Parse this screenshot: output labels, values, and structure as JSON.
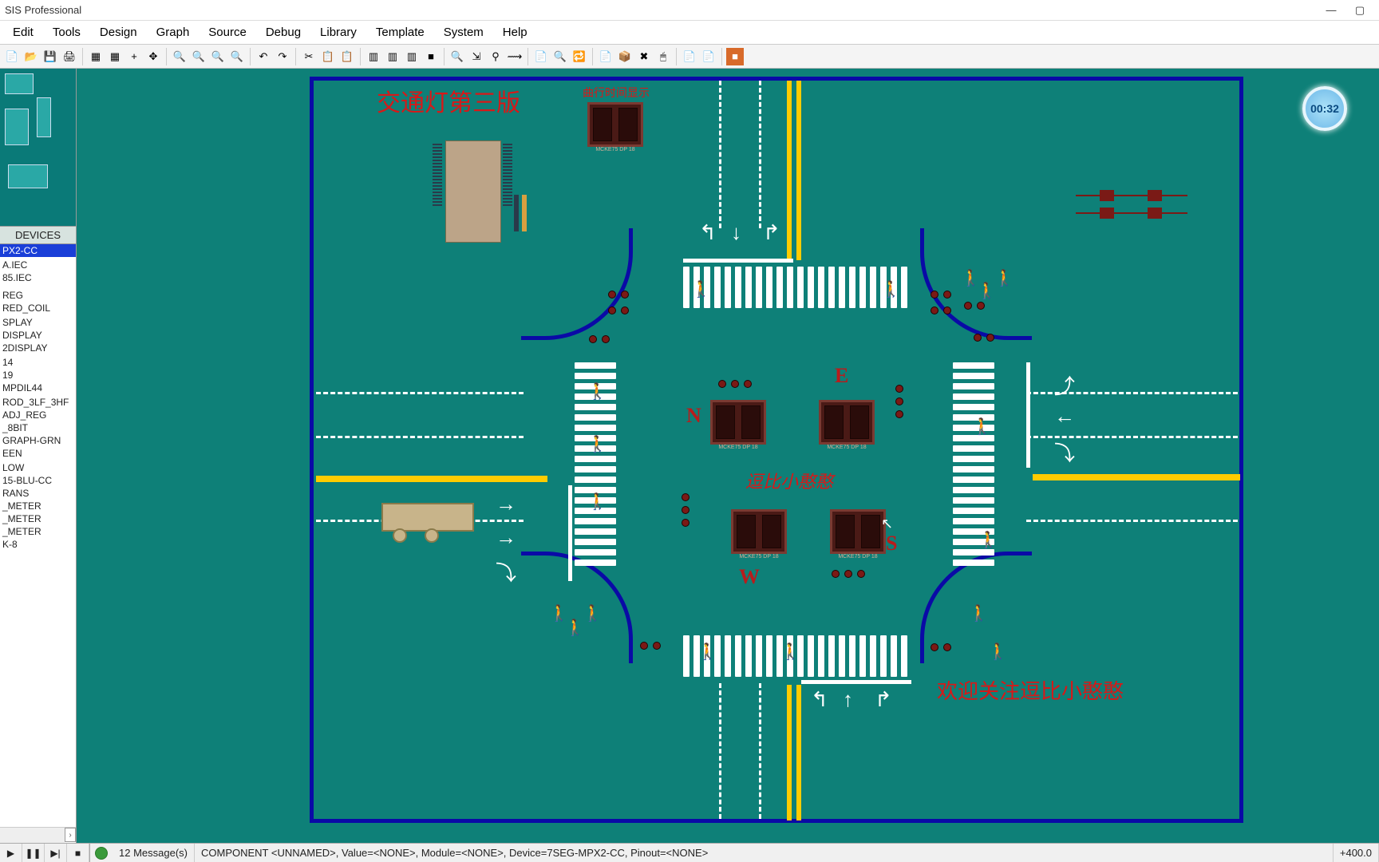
{
  "title": "SIS Professional",
  "menu": [
    "Edit",
    "Tools",
    "Design",
    "Graph",
    "Source",
    "Debug",
    "Library",
    "Template",
    "System",
    "Help"
  ],
  "toolbar_icons": [
    "new-icon",
    "open-icon",
    "save-icon",
    "print-icon",
    "region-icon",
    "grid-icon",
    "origin-icon",
    "pan-icon",
    "zoom-in-icon",
    "zoom-out-icon",
    "zoom-all-icon",
    "zoom-area-icon",
    "undo-icon",
    "redo-icon",
    "cut-icon",
    "copy-icon",
    "paste-icon",
    "block-copy-icon",
    "block-move-icon",
    "block-rotate-icon",
    "block-delete-icon",
    "zoom-sheet-icon",
    "wire-repair-icon",
    "search-tag-icon",
    "trace-icon",
    "netlist-icon",
    "find-icon",
    "replace-icon",
    "create-icon",
    "package-icon",
    "decompose-icon",
    "pick-icon",
    "bom-icon",
    "erc-icon",
    "ares-icon"
  ],
  "toolbar_glyphs": [
    "📄",
    "📂",
    "💾",
    "🖨",
    "▦",
    "▦",
    "+",
    "✥",
    "🔍",
    "🔍",
    "🔍",
    "🔍",
    "↶",
    "↷",
    "✂",
    "📋",
    "📋",
    "▥",
    "▥",
    "▥",
    "■",
    "🔍",
    "⇲",
    "⚲",
    "⟿",
    "📄",
    "🔍",
    "🔁",
    "📄",
    "📦",
    "✖",
    "🖱",
    "📄",
    "📄",
    "■"
  ],
  "devices_header": "DEVICES",
  "devices": [
    "PX2-CC",
    "",
    "A.IEC",
    "85.IEC",
    "",
    "",
    "",
    "REG",
    "RED_COIL",
    "",
    "SPLAY",
    "DISPLAY",
    "2DISPLAY",
    "",
    "14",
    "19",
    "MPDIL44",
    "",
    "ROD_3LF_3HF",
    "ADJ_REG",
    "_8BIT",
    "GRAPH-GRN",
    "EEN",
    "",
    "LOW",
    "15-BLU-CC",
    "RANS",
    "_METER",
    "_METER",
    "_METER",
    "K-8"
  ],
  "selected_device_index": 0,
  "canvas": {
    "title_cn": "交通灯第三版",
    "timer_caption": "曲行时间显示",
    "center_caption": "逗比小憨憨",
    "welcome_caption": "欢迎关注逗比小憨憨",
    "dir_n": "N",
    "dir_e": "E",
    "dir_s": "S",
    "dir_w": "W",
    "timer_value": "00:32"
  },
  "sim": {
    "play": "▶",
    "pause": "❚❚",
    "step": "▶|",
    "stop": "■"
  },
  "status": {
    "messages": "12 Message(s)",
    "component": "COMPONENT <UNNAMED>, Value=<NONE>, Module=<NONE>, Device=7SEG-MPX2-CC, Pinout=<NONE>",
    "coord": "+400.0"
  }
}
